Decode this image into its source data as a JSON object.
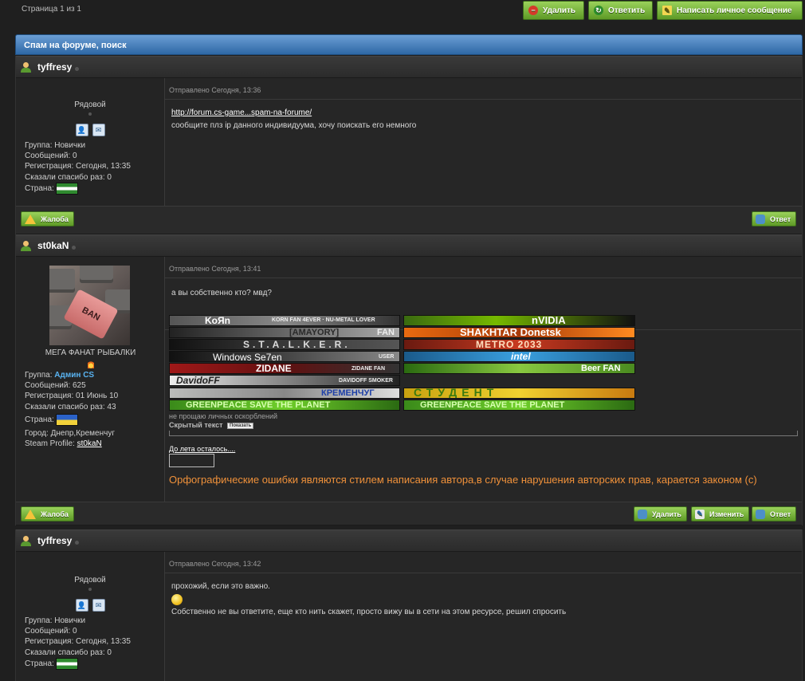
{
  "topbar": {
    "page_info": "Страница 1 из 1",
    "delete": "Удалить",
    "reply": "Ответить",
    "message": "Написать личное сообщение"
  },
  "topic_title": "Спам на форуме, поиск",
  "common": {
    "complain": "Жалоба",
    "reply": "Ответ",
    "delete": "Удалить",
    "edit": "Изменить"
  },
  "posts": [
    {
      "username": "tyffresy",
      "rank": "Рядовой",
      "group_label": "Группа: ",
      "group": "Новички",
      "messages": "Сообщений: 0",
      "registered": "Регистрация: Сегодня, 13:35",
      "thanks": "Сказали спасибо раз: 0",
      "country": "Страна:",
      "date": "Отправлено Сегодня, 13:36",
      "link": "http://forum.cs-game...spam-na-forume/",
      "text": "сообщите плз ip данного индивидуума, хочу поискать его немного"
    },
    {
      "username": "st0kaN",
      "avatar_key": "BAN",
      "rank": "МЕГА ФАНАТ РЫБАЛКИ",
      "group_label": "Группа: ",
      "group": "Админ CS",
      "messages": "Сообщений: 625",
      "registered": "Регистрация: 01 Июнь 10",
      "thanks": "Сказали спасибо раз: 43",
      "country": "Страна:",
      "city": "Город: Днепр,Кременчуг",
      "steam_label": "Steam Profile: ",
      "steam": "st0kaN",
      "date": "Отправлено Сегодня, 13:41",
      "text": "а вы собственно кто? мвд?",
      "banners_left": [
        "KoЯn",
        "KORN FAN 4EVER · NU-METAL LOVER",
        "[AMAYORY]",
        "FAN",
        "S.T.A.L.K.E.R.",
        "Windows Se7en",
        "USER",
        "ZIDANE",
        "ZIDANE FAN",
        "DavidoFF",
        "DAVIDOFF SMOKER",
        "КРЕМЕНЧУГ",
        "GREENPEACE SAVE THE PLANET"
      ],
      "banners_right": [
        "nVIDIA",
        "SHAKHTAR Donetsk",
        "METRO 2033",
        "intel",
        "Beer FAN",
        "СТУДЕНТ",
        "GREENPEACE SAVE THE PLANET"
      ],
      "sig_note": "не прощаю личных оскорблений",
      "hidden_text": "Скрытый текст",
      "show_btn": "Показать",
      "countdown": "До лета осталось....",
      "orange_text": "Орфографические ошибки являются стилем написания автора,в случае нарушения авторских прав, карается законом (с)"
    },
    {
      "username": "tyffresy",
      "rank": "Рядовой",
      "group_label": "Группа: ",
      "group": "Новички",
      "messages": "Сообщений: 0",
      "registered": "Регистрация: Сегодня, 13:35",
      "thanks": "Сказали спасибо раз: 0",
      "country": "Страна:",
      "date": "Отправлено Сегодня, 13:42",
      "text1": "прохожий, если это важно.",
      "text2": "Собственно не вы ответите, еще кто нить скажет, просто вижу вы в сети на этом ресурсе, решил спросить"
    }
  ],
  "colors": {
    "accent_green": "#5e9a26",
    "header_blue": "#2e68a6",
    "admin_blue": "#59b3f1",
    "orange": "#f0913a"
  }
}
